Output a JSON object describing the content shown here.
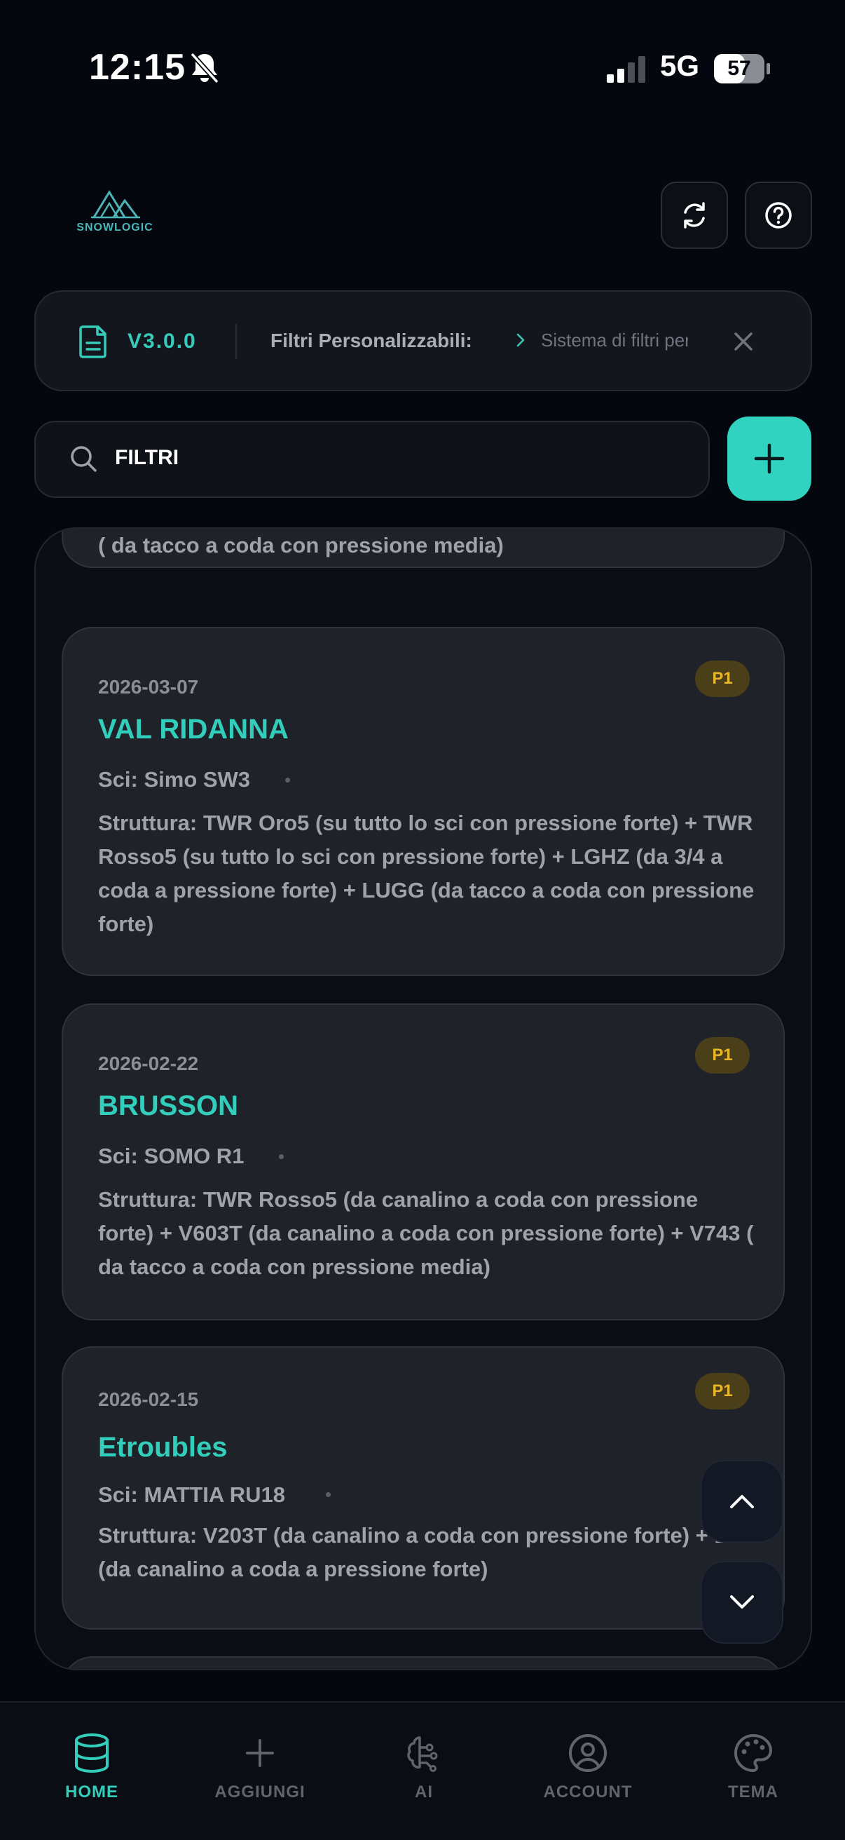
{
  "status_bar": {
    "time": "12:15",
    "network": "5G",
    "battery": "57"
  },
  "header": {
    "logo_text": "SNOWLOGIC",
    "refresh_icon": "refresh-icon",
    "help_icon": "help-icon"
  },
  "banner": {
    "version": "V3.0.0",
    "title": "Filtri Personalizzabili:",
    "message": "Sistema di filtri personalizzabili"
  },
  "search": {
    "value": "FILTRI"
  },
  "colors": {
    "accent": "#2fd3bf",
    "badge_text": "#e7b52a",
    "background": "#05070e"
  },
  "entries": [
    {
      "partial_text": "( da tacco a coda con pressione media)"
    },
    {
      "date": "2026-03-07",
      "badge": "P1",
      "title": "VAL RIDANNA",
      "ski": "Sci: Simo SW3",
      "structure": "Struttura: TWR Oro5 (su tutto lo sci con pressione forte) + TWR Rosso5 (su tutto lo sci con pressione forte) + LGHZ (da 3/4 a coda a pressione forte) + LUGG (da tacco a coda con pressione forte)"
    },
    {
      "date": "2026-02-22",
      "badge": "P1",
      "title": "BRUSSON",
      "ski": "Sci: SOMO R1",
      "structure": "Struttura: TWR Rosso5 (da canalino a coda con pressione forte) + V603T (da canalino a coda con pressione forte) + V743 ( da tacco a coda con pressione media)"
    },
    {
      "date": "2026-02-15",
      "badge": "P1",
      "title": "Etroubles",
      "ski": "Sci: MATTIA RU18",
      "structure": "Struttura: V203T (da canalino a coda con pressione forte) + LF+ (da canalino a coda a pressione forte)"
    }
  ],
  "bottom_nav": [
    {
      "label": "HOME",
      "icon": "database-icon",
      "active": true
    },
    {
      "label": "AGGIUNGI",
      "icon": "plus-icon",
      "active": false
    },
    {
      "label": "AI",
      "icon": "brain-icon",
      "active": false
    },
    {
      "label": "ACCOUNT",
      "icon": "user-circle-icon",
      "active": false
    },
    {
      "label": "TEMA",
      "icon": "palette-icon",
      "active": false
    }
  ]
}
